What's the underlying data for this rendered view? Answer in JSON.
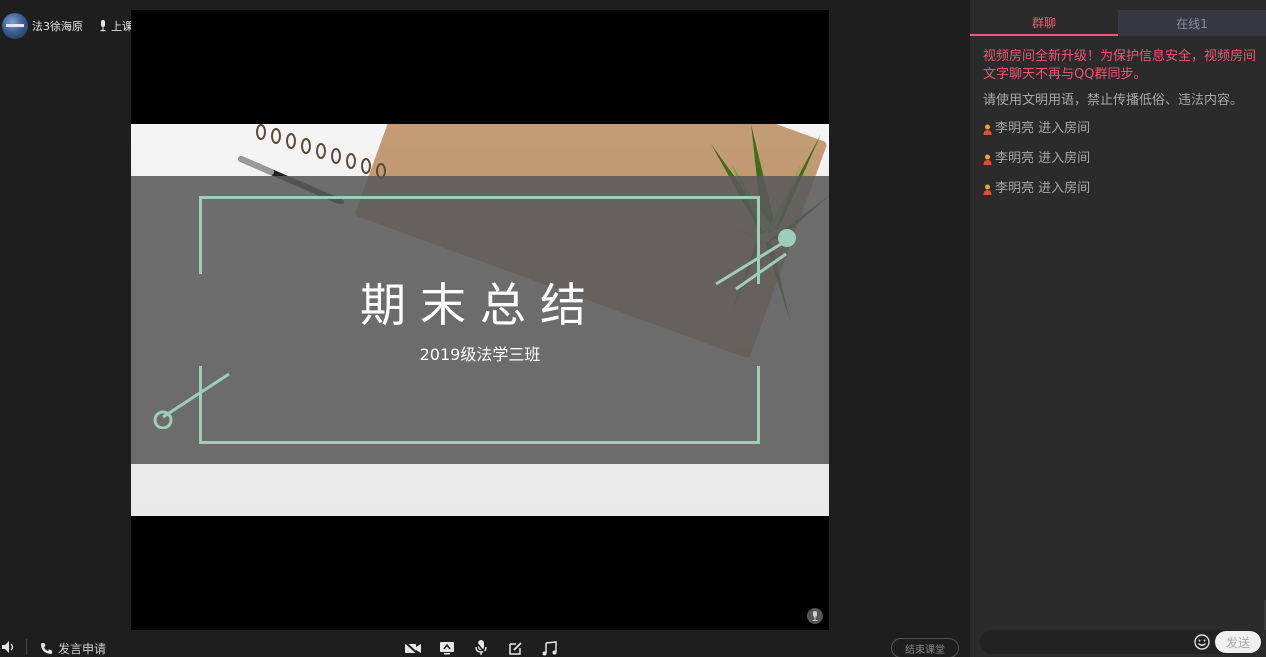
{
  "header": {
    "teacher_name": "法3徐海原",
    "status": "上课中"
  },
  "slide": {
    "title": "期末总结",
    "subtitle": "2019级法学三班"
  },
  "toolbar": {
    "request_label": "发言申请",
    "end_label": "结束课堂"
  },
  "panel": {
    "tabs": [
      {
        "label": "群聊",
        "active": true
      },
      {
        "label": "在线1",
        "active": false
      }
    ],
    "notice": "视频房间全新升级！为保护信息安全，视频房间文字聊天不再与QQ群同步。",
    "rule": "请使用文明用语，禁止传播低俗、违法内容。",
    "joins": [
      "李明亮 进入房间",
      "李明亮 进入房间",
      "李明亮 进入房间"
    ],
    "send_label": "发送"
  },
  "colors": {
    "accent": "#e85a78",
    "notice": "#f05474",
    "frame": "#9ecdb8"
  },
  "icons": [
    "avatar",
    "mic-icon",
    "speaker-icon",
    "phone-icon",
    "camera-off-icon",
    "screen-share-icon",
    "microphone-icon",
    "edit-icon",
    "music-icon",
    "user-icon",
    "emoji-icon"
  ]
}
